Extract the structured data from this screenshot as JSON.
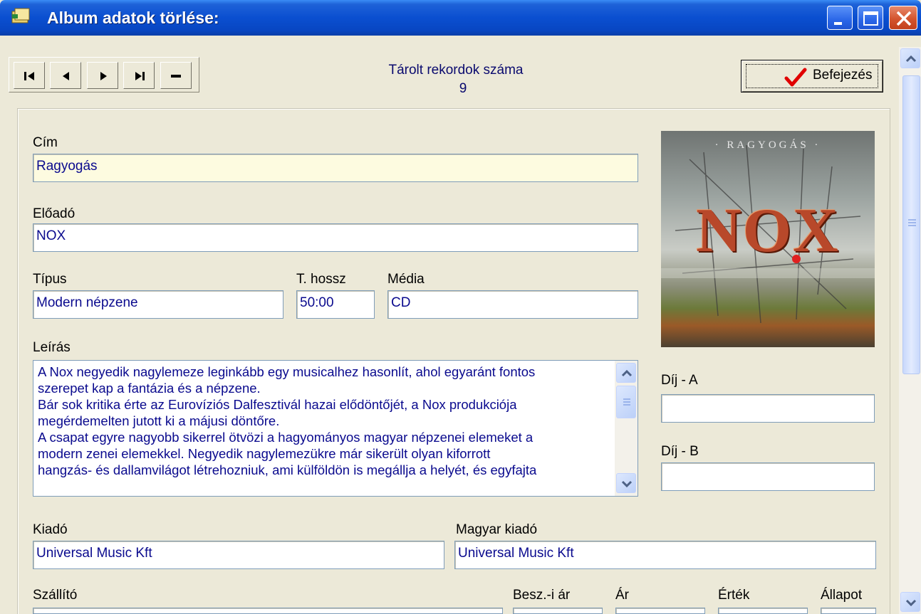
{
  "window": {
    "title": "Album adatok törlése:"
  },
  "toolbar": {
    "nav_buttons": [
      "first-record",
      "previous-record",
      "next-record",
      "last-record",
      "delete-record"
    ],
    "record_count_label": "Tárolt rekordok száma",
    "record_count": "9",
    "finish_label": "Befejezés"
  },
  "form": {
    "cim": {
      "label": "Cím",
      "value": "Ragyogás"
    },
    "eloado": {
      "label": "Előadó",
      "value": "NOX"
    },
    "tipus": {
      "label": "Típus",
      "value": "Modern népzene"
    },
    "hossz": {
      "label": "T. hossz",
      "value": "50:00"
    },
    "media": {
      "label": "Média",
      "value": "CD"
    },
    "leiras": {
      "label": "Leírás",
      "lines": [
        "A Nox negyedik nagylemeze leginkább egy musicalhez hasonlít, ahol egyaránt fontos",
        "szerepet kap a fantázia és a népzene.",
        "Bár sok kritika érte az Eurovíziós Dalfesztivál hazai elődöntőjét, a Nox produkciója",
        "megérdemelten jutott ki a májusi döntőre.",
        "A csapat egyre nagyobb sikerrel ötvözi a hagyományos magyar népzenei elemeket a",
        "modern zenei elemekkel. Negyedik nagylemezükre már sikerült olyan kiforrott",
        "hangzás- és dallamvilágot létrehozniuk, ami külföldön is megállja a helyét, és egyfajta"
      ]
    },
    "dij_a": {
      "label": "Díj - A",
      "value": ""
    },
    "dij_b": {
      "label": "Díj - B",
      "value": ""
    },
    "kiado": {
      "label": "Kiadó",
      "value": "Universal Music Kft"
    },
    "magyar_kiado": {
      "label": "Magyar kiadó",
      "value": "Universal Music Kft"
    },
    "szallito": {
      "label": "Szállító"
    },
    "besz_ar": {
      "label": "Besz.-i ár"
    },
    "ar": {
      "label": "Ár"
    },
    "ertek": {
      "label": "Érték"
    },
    "allapot": {
      "label": "Állapot"
    }
  },
  "cover": {
    "title": "· RAGYOGÁS ·",
    "band": "NOX"
  },
  "colors": {
    "titlebar": "#0a4fd0",
    "field_text": "#0a0a8e",
    "highlight_field": "#fdfbe0"
  }
}
